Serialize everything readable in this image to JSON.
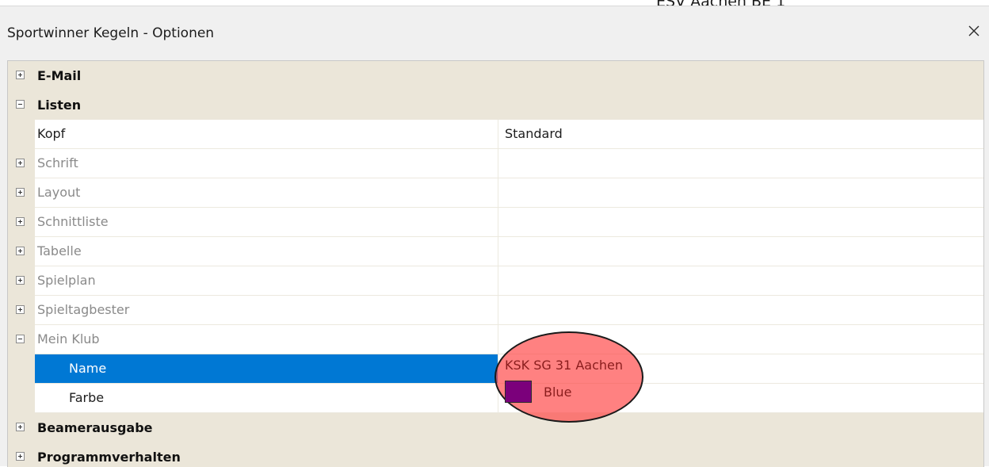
{
  "background_window": {
    "text": "ESV Aachen BE 1"
  },
  "dialog": {
    "title": "Sportwinner Kegeln - Optionen"
  },
  "categories": {
    "email": "E-Mail",
    "listen": "Listen",
    "beamer": "Beamerausgabe",
    "programm": "Programmverhalten"
  },
  "listen": {
    "kopf": {
      "name": "Kopf",
      "value": "Standard"
    },
    "schrift": "Schrift",
    "layout": "Layout",
    "schnittliste": "Schnittliste",
    "tabelle": "Tabelle",
    "spielplan": "Spielplan",
    "spieltagbester": "Spieltagbester",
    "mein_klub": {
      "label": "Mein Klub",
      "name": {
        "name": "Name",
        "value": "KSK SG 31 Aachen"
      },
      "farbe": {
        "name": "Farbe",
        "value": "Blue",
        "swatch_color": "#7b007b"
      }
    }
  },
  "colors": {
    "selection": "#0078d4",
    "category_bg": "#ebe6d9",
    "highlight_overlay": "#ff4646"
  },
  "icons": {
    "close": "close-icon",
    "expand": "expand-icon",
    "collapse": "collapse-icon"
  }
}
